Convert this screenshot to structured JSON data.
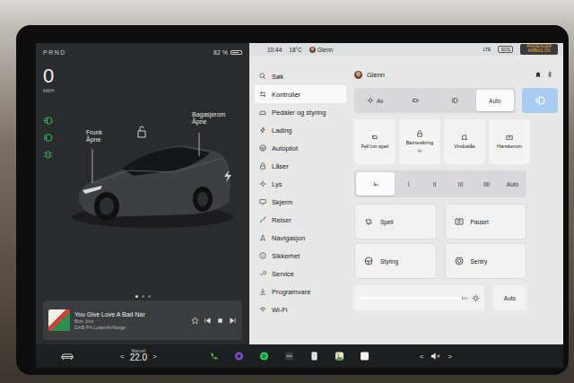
{
  "left_panel": {
    "gear": "PRND",
    "battery": {
      "reading": "82 %",
      "level": 0.82
    },
    "speed": "0",
    "speed_unit": "KM/H",
    "frunk": {
      "title": "Frunk",
      "action": "Åpne"
    },
    "trunk": {
      "title": "Bagasjerom",
      "action": "Åpne"
    },
    "page_dots": [
      {
        "selected": true
      },
      {
        "selected": false
      },
      {
        "selected": false
      }
    ],
    "media": {
      "title": "You Give Love A Bad Nar",
      "artist": "Bon Jovi",
      "source": "DAB P4 LydenAvNorge",
      "favorite": false
    }
  },
  "status_bar": {
    "time": "10:44",
    "temperature": "18°C",
    "user": "Glenn",
    "network": "LTE",
    "sos": "SOS",
    "airbag": "PASSENGER AIRBAG ON"
  },
  "sidebar": {
    "items": [
      {
        "label": "Søk",
        "selected": false
      },
      {
        "label": "Kontroller",
        "selected": true
      },
      {
        "label": "Pedaler og styring",
        "selected": false
      },
      {
        "label": "Lading",
        "selected": false
      },
      {
        "label": "Autopilot",
        "selected": false
      },
      {
        "label": "Låser",
        "selected": false
      },
      {
        "label": "Lys",
        "selected": false
      },
      {
        "label": "Skjerm",
        "selected": false
      },
      {
        "label": "Reiser",
        "selected": false
      },
      {
        "label": "Navigasjon",
        "selected": false
      },
      {
        "label": "Sikkerhet",
        "selected": false
      },
      {
        "label": "Service",
        "selected": false
      },
      {
        "label": "Programvare",
        "selected": false
      },
      {
        "label": "Wi-Fi",
        "selected": false
      }
    ]
  },
  "controls": {
    "user": "Glenn",
    "lights": [
      {
        "label": "Av",
        "selected": false
      },
      {
        "selected": false
      },
      {
        "selected": false
      },
      {
        "label": "Auto",
        "selected": true
      }
    ],
    "headlight_button": {
      "on": true
    },
    "toggles": [
      {
        "label": "Fell inn speil"
      },
      {
        "label": "Barnesikring",
        "sub": "Av"
      },
      {
        "label": "Vinduslås"
      },
      {
        "label": "Hanskerom"
      }
    ],
    "wipers": [
      {
        "selected": true
      },
      {
        "label": "I",
        "selected": false
      },
      {
        "label": "II",
        "selected": false
      },
      {
        "label": "III",
        "selected": false
      },
      {
        "label": "IIII",
        "selected": false
      },
      {
        "label": "Auto",
        "selected": false
      }
    ],
    "cards": [
      {
        "label": "Speil"
      },
      {
        "label": "Pauset"
      },
      {
        "label": "Styring"
      },
      {
        "label": "Sentry"
      }
    ],
    "brightness": {
      "level": 0.95,
      "auto": "Auto"
    }
  },
  "bottom_bar": {
    "climate_mode": "Manuell",
    "temperature": "22.0",
    "temp_down": "<",
    "temp_up": ">",
    "volume_down": "<",
    "volume_up": ">"
  }
}
